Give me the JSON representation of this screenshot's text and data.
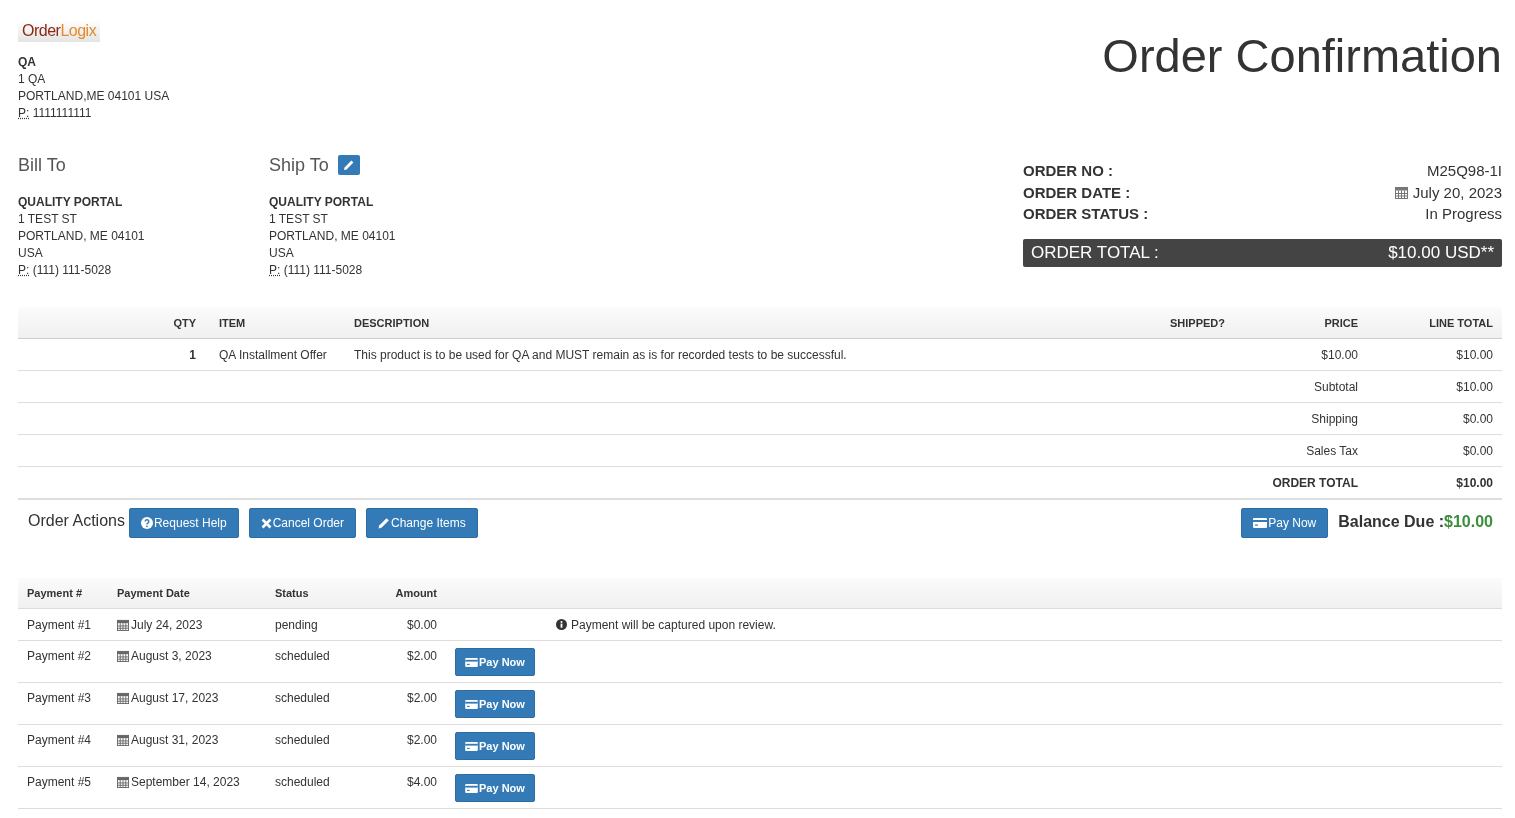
{
  "logo": {
    "first": "Order",
    "second": "Logix"
  },
  "company": {
    "name": "QA",
    "lines": [
      "1 QA",
      "PORTLAND,ME 04101 USA"
    ],
    "phone_label": "P:",
    "phone": "1111111111"
  },
  "title": "Order Confirmation",
  "addresses": [
    {
      "heading": "Bill To",
      "editable": false,
      "name": "QUALITY PORTAL",
      "lines": [
        "1 TEST ST",
        "PORTLAND, ME 04101",
        "USA"
      ],
      "phone_label": "P:",
      "phone": "(111) 111-5028"
    },
    {
      "heading": "Ship To",
      "editable": true,
      "name": "QUALITY PORTAL",
      "lines": [
        "1 TEST ST",
        "PORTLAND, ME 04101",
        "USA"
      ],
      "phone_label": "P:",
      "phone": "(111) 111-5028"
    }
  ],
  "order_info": [
    {
      "label": "ORDER NO :",
      "value": "M25Q98-1I",
      "kind": "text"
    },
    {
      "label": "ORDER DATE :",
      "value": "July 20, 2023",
      "kind": "date"
    },
    {
      "label": "ORDER STATUS :",
      "value": "In Progress",
      "kind": "text"
    }
  ],
  "order_total_bar": {
    "label": "ORDER TOTAL :",
    "value": "$10.00 USD**"
  },
  "items_table": {
    "columns": [
      "QTY",
      "ITEM",
      "DESCRIPTION",
      "SHIPPED?",
      "PRICE",
      "LINE TOTAL"
    ],
    "rows": [
      {
        "qty": "1",
        "item": "QA Installment Offer",
        "description": "This product is to be used for QA and MUST remain as is for recorded tests to be successful.",
        "shipped": "",
        "price": "$10.00",
        "line_total": "$10.00"
      }
    ],
    "summary": [
      {
        "label": "Subtotal",
        "value": "$10.00",
        "bold": false
      },
      {
        "label": "Shipping",
        "value": "$0.00",
        "bold": false
      },
      {
        "label": "Sales Tax",
        "value": "$0.00",
        "bold": false
      },
      {
        "label": "ORDER TOTAL",
        "value": "$10.00",
        "bold": true
      }
    ]
  },
  "order_actions": {
    "label": "Order Actions",
    "buttons": [
      {
        "label": "Request Help",
        "kind": "help"
      },
      {
        "label": "Cancel Order",
        "kind": "cancel"
      },
      {
        "label": "Change Items",
        "kind": "edit"
      }
    ],
    "pay_button": "Pay Now",
    "balance_label": "Balance Due :",
    "balance_value": "$10.00"
  },
  "payments_table": {
    "columns": [
      "Payment #",
      "Payment Date",
      "Status",
      "Amount"
    ],
    "rows": [
      {
        "payment": "Payment #1",
        "date": "July 24, 2023",
        "status": "pending",
        "amount": "$0.00",
        "note": "Payment will be captured upon review."
      },
      {
        "payment": "Payment #2",
        "date": "August 3, 2023",
        "status": "scheduled",
        "amount": "$2.00",
        "pay_button": "Pay Now"
      },
      {
        "payment": "Payment #3",
        "date": "August 17, 2023",
        "status": "scheduled",
        "amount": "$2.00",
        "pay_button": "Pay Now"
      },
      {
        "payment": "Payment #4",
        "date": "August 31, 2023",
        "status": "scheduled",
        "amount": "$2.00",
        "pay_button": "Pay Now"
      },
      {
        "payment": "Payment #5",
        "date": "September 14, 2023",
        "status": "scheduled",
        "amount": "$4.00",
        "pay_button": "Pay Now"
      }
    ]
  }
}
